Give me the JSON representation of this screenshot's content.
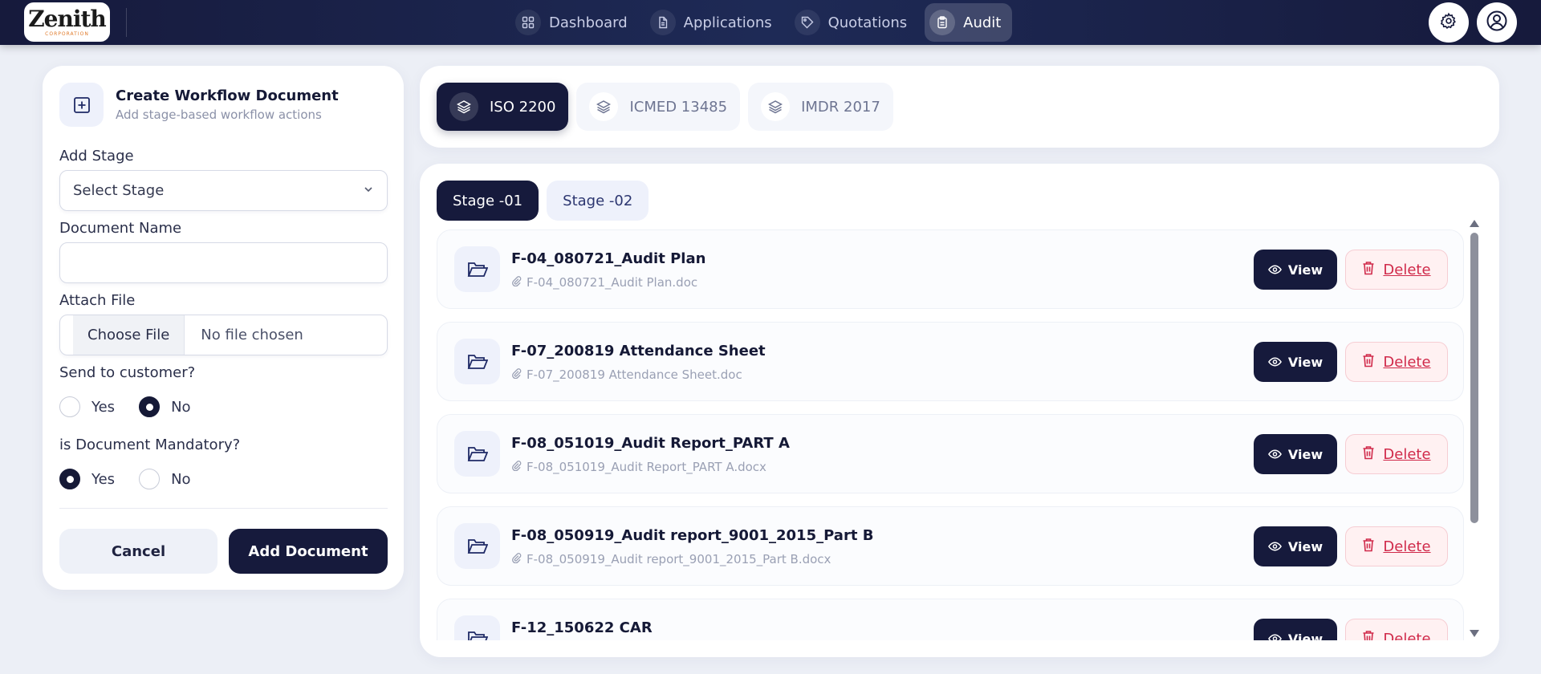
{
  "colors": {
    "navy": "#161a3c",
    "danger": "#d02a4a",
    "accent": "#e07a2a"
  },
  "brand": {
    "logo_text": "Zenith",
    "logo_sub": "CORPORATION"
  },
  "nav": [
    {
      "label": "Dashboard",
      "icon": "grid-icon"
    },
    {
      "label": "Applications",
      "icon": "document-icon"
    },
    {
      "label": "Quotations",
      "icon": "tag-icon"
    },
    {
      "label": "Audit",
      "icon": "clipboard-icon",
      "active": true
    }
  ],
  "form": {
    "title": "Create Workflow Document",
    "subtitle": "Add stage-based workflow actions",
    "stage_label": "Add Stage",
    "stage_value": "Select Stage",
    "doc_name_label": "Document Name",
    "doc_name_value": "",
    "attach_label": "Attach File",
    "choose_file": "Choose File",
    "file_status": "No file chosen",
    "send_label": "Send to customer?",
    "send_yes": "Yes",
    "send_no": "No",
    "send_selected": "No",
    "mandatory_label": "is Document Mandatory?",
    "mandatory_yes": "Yes",
    "mandatory_no": "No",
    "mandatory_selected": "Yes",
    "cancel": "Cancel",
    "add": "Add Document"
  },
  "standards": [
    {
      "label": "ISO 2200",
      "active": true
    },
    {
      "label": "ICMED 13485"
    },
    {
      "label": "IMDR 2017"
    }
  ],
  "stages": [
    {
      "label": "Stage -01",
      "active": true
    },
    {
      "label": "Stage -02"
    }
  ],
  "documents": [
    {
      "title": "F-04_080721_Audit Plan",
      "file": "F-04_080721_Audit Plan.doc"
    },
    {
      "title": "F-07_200819 Attendance Sheet",
      "file": "F-07_200819 Attendance Sheet.doc"
    },
    {
      "title": "F-08_051019_Audit Report_PART A",
      "file": "F-08_051019_Audit Report_PART A.docx"
    },
    {
      "title": "F-08_050919_Audit report_9001_2015_Part B",
      "file": "F-08_050919_Audit report_9001_2015_Part B.docx"
    },
    {
      "title": "F-12_150622 CAR",
      "file": ""
    }
  ],
  "actions": {
    "view": "View",
    "delete": "Delete"
  }
}
